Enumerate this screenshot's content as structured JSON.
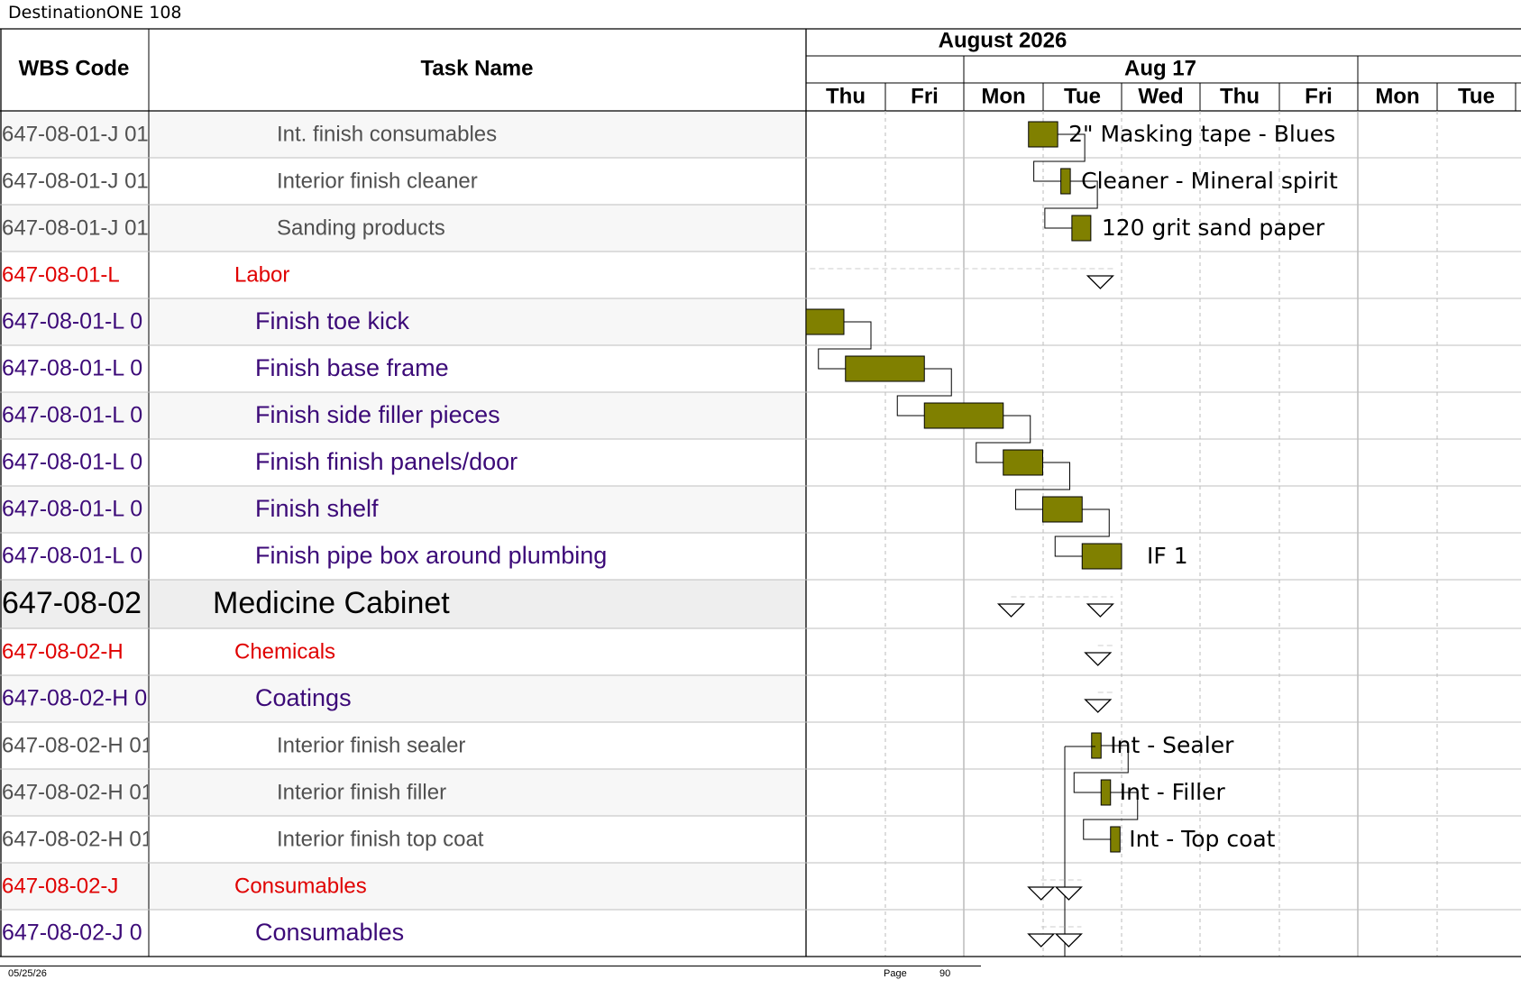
{
  "header": {
    "title": "DestinationONE 108"
  },
  "columns": {
    "wbs": "WBS Code",
    "task": "Task Name"
  },
  "timescale": {
    "month": "August 2026",
    "week": "Aug 17",
    "days": [
      "Thu",
      "Fri",
      "Mon",
      "Tue",
      "Wed",
      "Thu",
      "Fri",
      "Mon",
      "Tue"
    ]
  },
  "rows": [
    {
      "wbs": "647-08-01-J 01",
      "task": "Int. finish consumables",
      "level": "detail"
    },
    {
      "wbs": "647-08-01-J 01",
      "task": "Interior finish cleaner",
      "level": "detail"
    },
    {
      "wbs": "647-08-01-J 01",
      "task": "Sanding products",
      "level": "detail"
    },
    {
      "wbs": "647-08-01-L",
      "task": "Labor",
      "level": "group"
    },
    {
      "wbs": "647-08-01-L 0",
      "task": "Finish toe kick",
      "level": "task"
    },
    {
      "wbs": "647-08-01-L 0",
      "task": "Finish base frame",
      "level": "task"
    },
    {
      "wbs": "647-08-01-L 0",
      "task": "Finish side filler pieces",
      "level": "task"
    },
    {
      "wbs": "647-08-01-L 0",
      "task": "Finish finish panels/door",
      "level": "task"
    },
    {
      "wbs": "647-08-01-L 0",
      "task": "Finish shelf",
      "level": "task"
    },
    {
      "wbs": "647-08-01-L 0",
      "task": "Finish pipe box around plumbing",
      "level": "task"
    },
    {
      "wbs": "647-08-02",
      "task": "Medicine Cabinet",
      "level": "summary"
    },
    {
      "wbs": "647-08-02-H",
      "task": "Chemicals",
      "level": "group"
    },
    {
      "wbs": "647-08-02-H 0",
      "task": "Coatings",
      "level": "task"
    },
    {
      "wbs": "647-08-02-H 01",
      "task": "Interior finish sealer",
      "level": "detail"
    },
    {
      "wbs": "647-08-02-H 01",
      "task": "Interior finish filler",
      "level": "detail"
    },
    {
      "wbs": "647-08-02-H 01",
      "task": "Interior finish top coat",
      "level": "detail"
    },
    {
      "wbs": "647-08-02-J",
      "task": "Consumables",
      "level": "group"
    },
    {
      "wbs": "647-08-02-J 0",
      "task": "Consumables",
      "level": "task"
    }
  ],
  "bar_labels": [
    {
      "row": 0,
      "text": "2\" Masking tape - Blues"
    },
    {
      "row": 1,
      "text": "Cleaner - Mineral spirit"
    },
    {
      "row": 2,
      "text": "120 grit sand paper"
    },
    {
      "row": 9,
      "text": "IF 1"
    },
    {
      "row": 13,
      "text": "Int - Sealer"
    },
    {
      "row": 14,
      "text": "Int - Filler"
    },
    {
      "row": 15,
      "text": "Int - Top coat"
    }
  ],
  "footer": {
    "date": "05/25/26",
    "page_label": "Page",
    "page_number": "90"
  },
  "colors": {
    "bar": "#808000",
    "group_text": "#e00000",
    "task_text": "#3c0a78",
    "detail_text": "#505050",
    "summary_text": "#000000",
    "alt_row": "#f7f7f7"
  }
}
